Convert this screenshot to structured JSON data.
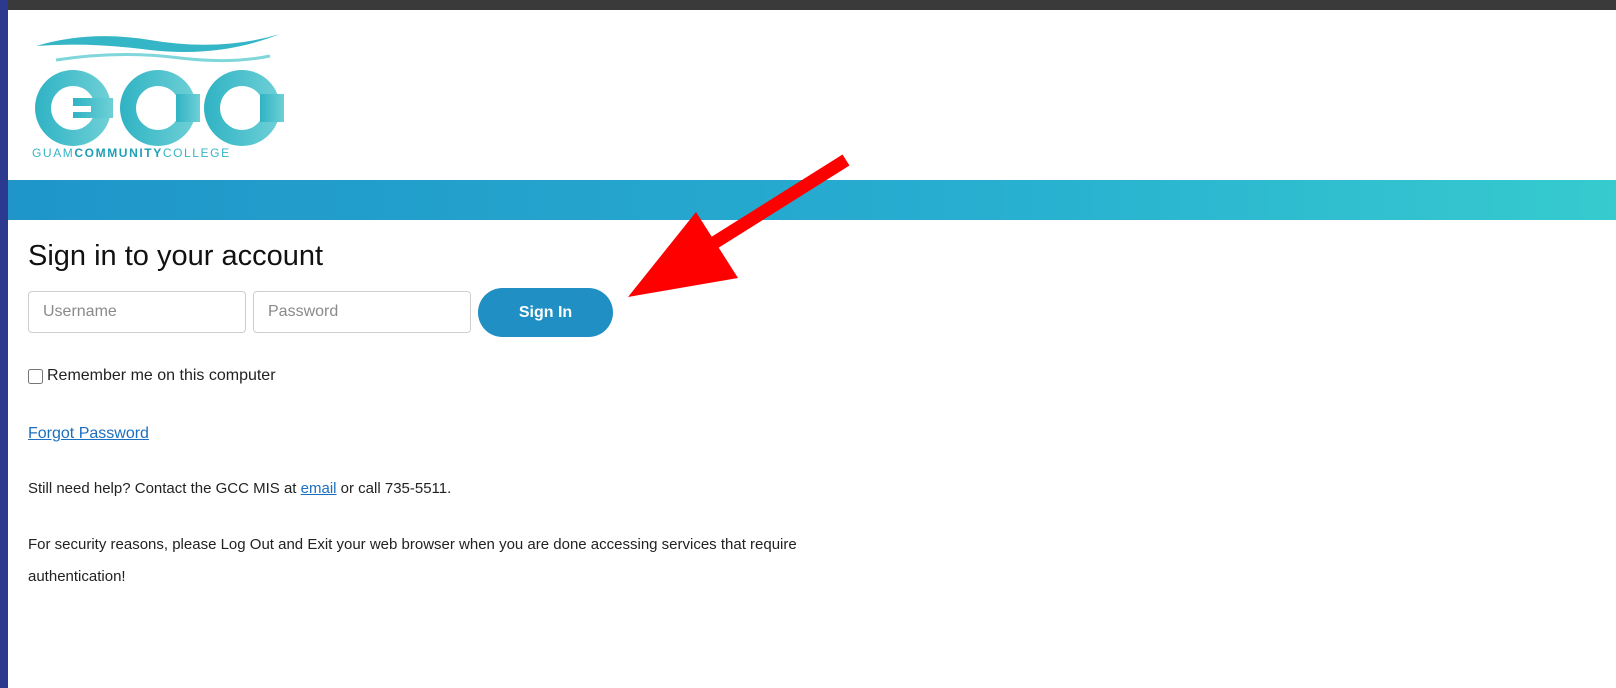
{
  "logo": {
    "letters": "GCC",
    "wordmark_part1": "GUAM",
    "wordmark_part2": "COMMUNITY",
    "wordmark_part3": "COLLEGE"
  },
  "login": {
    "heading": "Sign in to your account",
    "username_placeholder": "Username",
    "password_placeholder": "Password",
    "signin_label": "Sign In",
    "remember_label": "Remember me on this computer",
    "forgot_label": "Forgot Password"
  },
  "help": {
    "prefix": "Still need help? Contact the GCC MIS at ",
    "email_link": "email",
    "suffix": " or call 735-5511."
  },
  "security": {
    "text": "For security reasons, please Log Out and Exit your web browser when you are done accessing services that require authentication!"
  },
  "colors": {
    "brand_teal": "#34b6c6",
    "banner_start": "#1f95c9",
    "banner_end": "#36cbcf",
    "button": "#1f8fc4",
    "link": "#1a6fc0",
    "annotation_arrow": "#ff0000"
  }
}
